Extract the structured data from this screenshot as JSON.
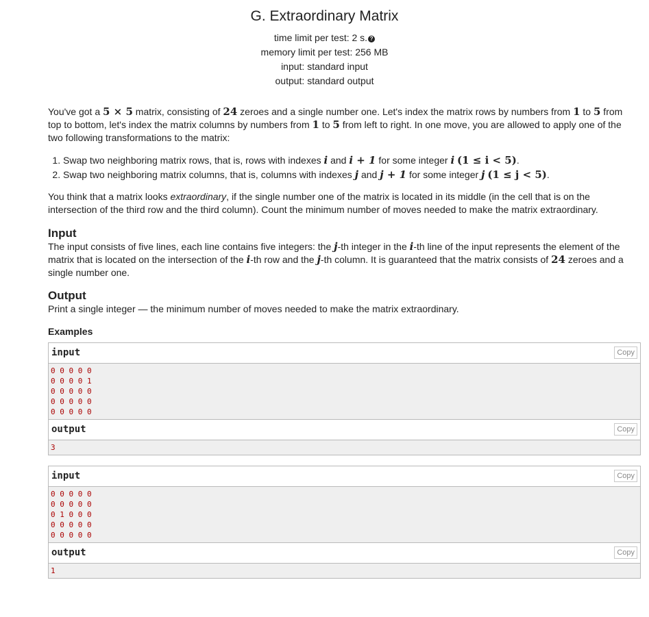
{
  "problem": {
    "title": "G. Extraordinary Matrix",
    "time_limit": "time limit per test: 2 s.",
    "memory_limit": "memory limit per test: 256 MB",
    "input": "input: standard input",
    "output": "output: standard output"
  },
  "statement": {
    "p1_a": "You've got a ",
    "p1_b": " matrix, consisting of ",
    "p1_c": " zeroes and a single number one. Let's index the matrix rows by numbers from ",
    "p1_d": " to ",
    "p1_e": " from top to bottom, let's index the matrix columns by numbers from ",
    "p1_f": " to ",
    "p1_g": " from left to right. In one move, you are allowed to apply one of the two following transformations to the matrix:",
    "li1_a": "Swap two neighboring matrix rows, that is, rows with indexes ",
    "li1_b": " and ",
    "li1_c": " for some integer ",
    "li2_a": "Swap two neighboring matrix columns, that is, columns with indexes ",
    "li2_b": " and ",
    "li2_c": " for some integer ",
    "p2_a": "You think that a matrix looks ",
    "p2_em": "extraordinary",
    "p2_b": ", if the single number one of the matrix is located in its middle (in the cell that is on the intersection of the third row and the third column). Count the minimum number of moves needed to make the matrix extraordinary."
  },
  "input_section": {
    "title": "Input",
    "t_a": "The input consists of five lines, each line contains five integers: the ",
    "t_b": "-th integer in the ",
    "t_c": "-th line of the input represents the element of the matrix that is located on the intersection of the ",
    "t_d": "-th row and the ",
    "t_e": "-th column. It is guaranteed that the matrix consists of ",
    "t_f": " zeroes and a single number one."
  },
  "output_section": {
    "title": "Output",
    "text": "Print a single integer — the minimum number of moves needed to make the matrix extraordinary."
  },
  "examples": {
    "title": "Examples",
    "copy_label": "Copy",
    "input_label": "input",
    "output_label": "output",
    "list": [
      {
        "input": [
          "0 0 0 0 0",
          "0 0 0 0 1",
          "0 0 0 0 0",
          "0 0 0 0 0",
          "0 0 0 0 0"
        ],
        "output": [
          "3"
        ]
      },
      {
        "input": [
          "0 0 0 0 0",
          "0 0 0 0 0",
          "0 1 0 0 0",
          "0 0 0 0 0",
          "0 0 0 0 0"
        ],
        "output": [
          "1"
        ]
      }
    ]
  },
  "math": {
    "five_by_five": "5 × 5",
    "n24": "24",
    "n1": "1",
    "n5": "5",
    "i": "i",
    "i_plus_1": "i + 1",
    "i_range": "(1 ≤ i < 5)",
    "j": "j",
    "j_plus_1": "j + 1",
    "j_range": "(1 ≤ j < 5)",
    "period": "."
  }
}
